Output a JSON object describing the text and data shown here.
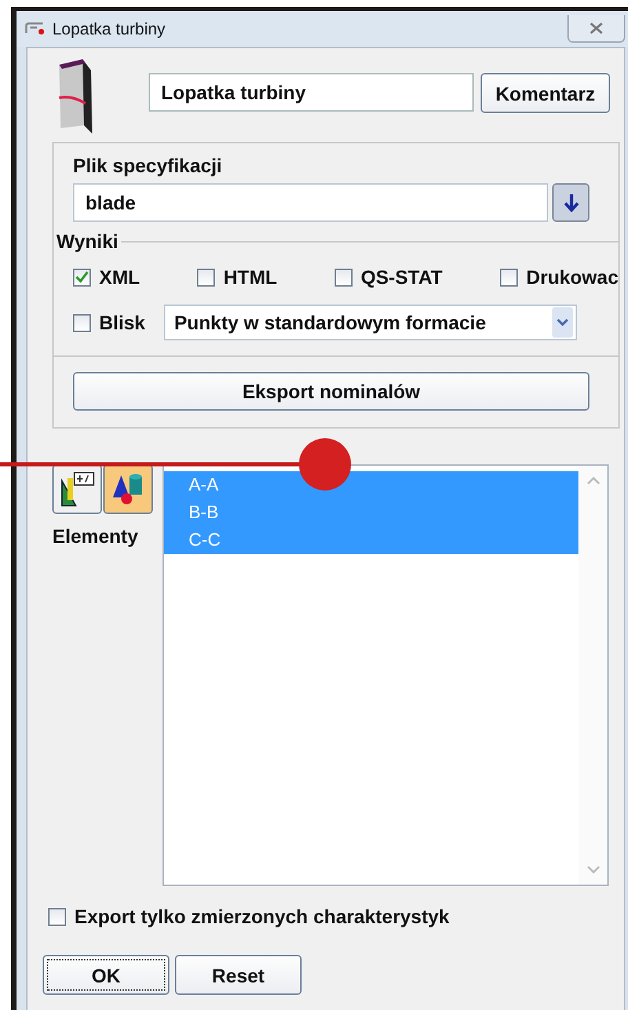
{
  "window": {
    "title": "Lopatka turbiny"
  },
  "name_field": {
    "value": "Lopatka turbiny"
  },
  "comment_button": "Komentarz",
  "spec": {
    "label": "Plik specyfikacji",
    "value": "blade"
  },
  "results": {
    "label": "Wyniki",
    "options": [
      {
        "label": "XML",
        "checked": true
      },
      {
        "label": "HTML",
        "checked": false
      },
      {
        "label": "QS-STAT",
        "checked": false
      },
      {
        "label": "Drukowac",
        "checked": false
      }
    ],
    "blisk": {
      "label": "Blisk",
      "checked": false
    },
    "format": {
      "value": "Punkty w standardowym formacie"
    }
  },
  "export_button": "Eksport nominalów",
  "elements": {
    "label": "Elementy",
    "tools": [
      {
        "kind": "ruler",
        "selected": false
      },
      {
        "kind": "shapes",
        "selected": true
      }
    ],
    "items": [
      {
        "label": "A-A",
        "selected": true
      },
      {
        "label": "B-B",
        "selected": true
      },
      {
        "label": "C-C",
        "selected": true
      }
    ]
  },
  "measured_only": {
    "label": "Export tylko zmierzonych charakterystyk",
    "checked": false
  },
  "buttons": [
    {
      "label": "OK",
      "kind": "default"
    },
    {
      "label": "Reset",
      "kind": "normal"
    }
  ]
}
